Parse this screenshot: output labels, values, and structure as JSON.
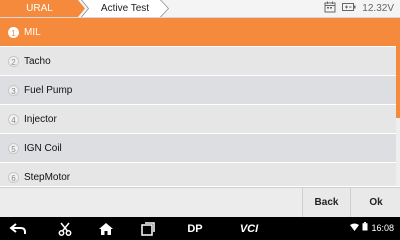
{
  "header": {
    "breadcrumb": [
      "URAL",
      "Active Test"
    ],
    "voltage": "12.32V",
    "icons": [
      "calendar-icon",
      "battery-icon"
    ]
  },
  "list": {
    "items": [
      {
        "num": "1",
        "label": "MIL",
        "selected": true
      },
      {
        "num": "2",
        "label": "Tacho",
        "selected": false
      },
      {
        "num": "3",
        "label": "Fuel Pump",
        "selected": false
      },
      {
        "num": "4",
        "label": "Injector",
        "selected": false
      },
      {
        "num": "5",
        "label": "IGN Coil",
        "selected": false
      },
      {
        "num": "6",
        "label": "StepMotor",
        "selected": false
      }
    ]
  },
  "actions": {
    "back_label": "Back",
    "ok_label": "Ok"
  },
  "navbar": {
    "dp_label": "DP",
    "vci_label": "VCI",
    "time": "16:08",
    "icons": [
      "back-icon",
      "scissors-icon",
      "home-icon",
      "recent-apps-icon",
      "dp-icon",
      "vci-icon",
      "wifi-icon",
      "battery-icon"
    ]
  },
  "colors": {
    "accent": "#f58a3c",
    "row_odd": "#e6e6e6",
    "row_even": "#dcdee2"
  }
}
